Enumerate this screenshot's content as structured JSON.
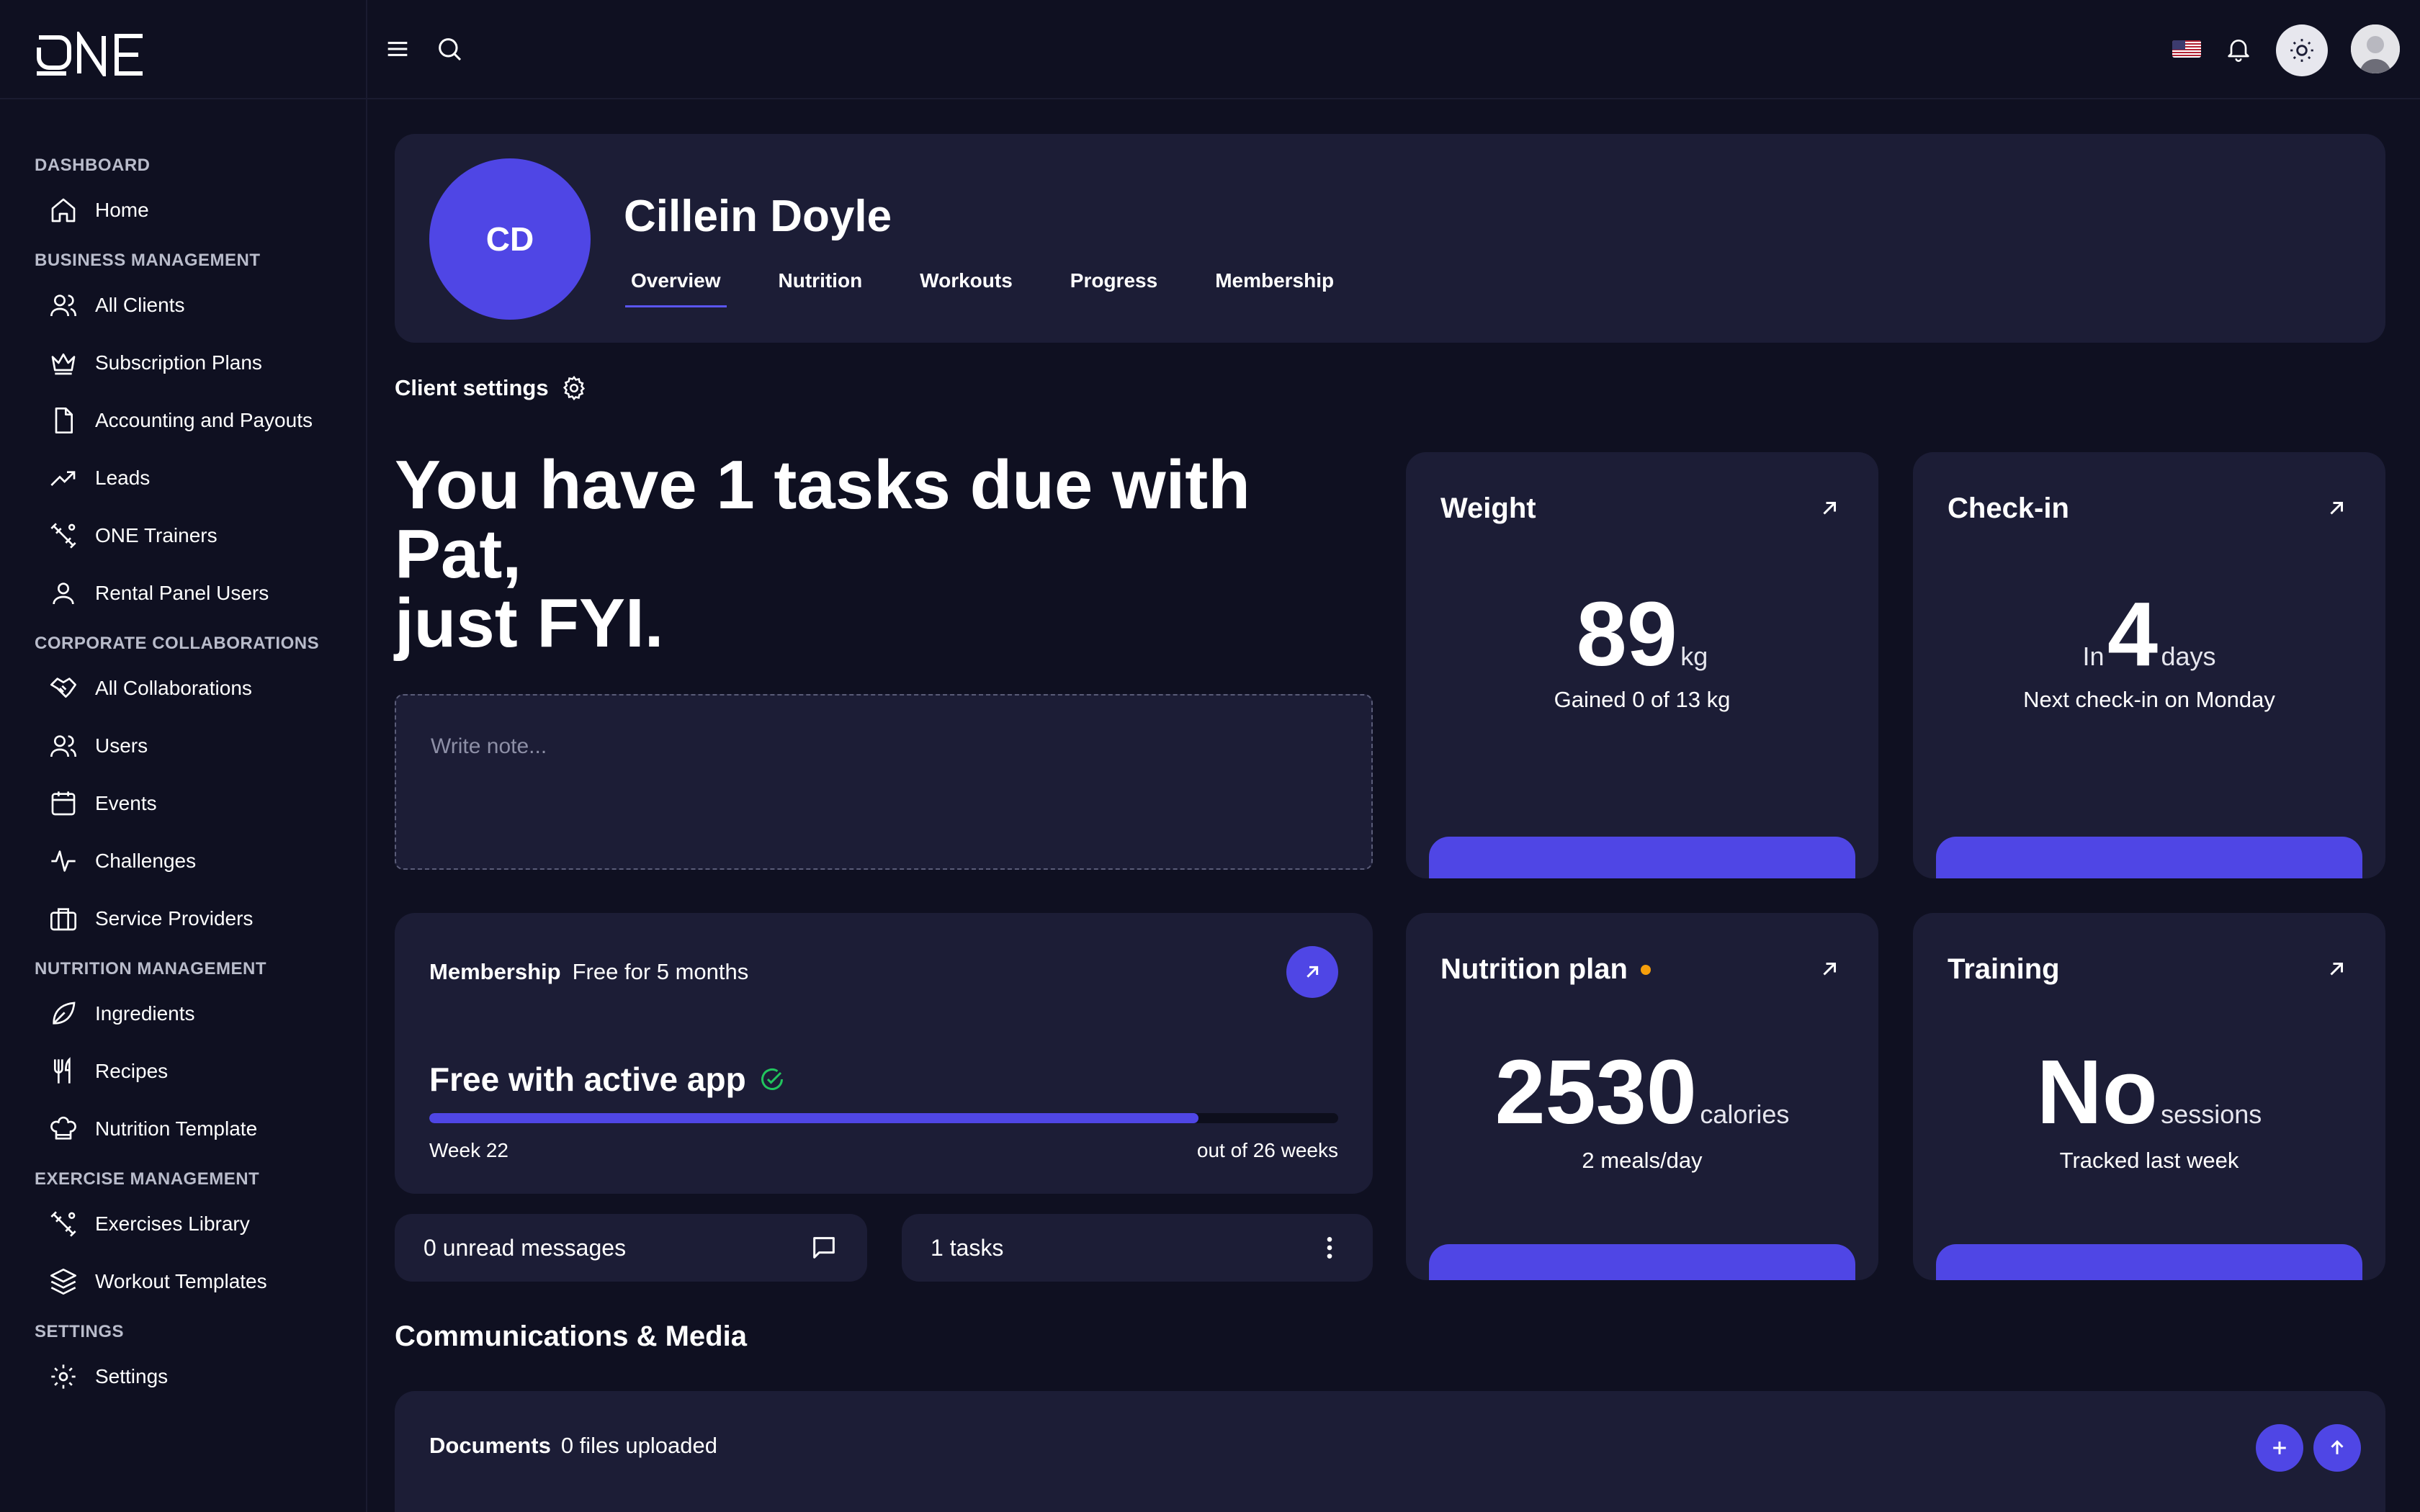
{
  "app": {
    "logo_text": "ONE"
  },
  "sidebar": {
    "sections": [
      {
        "title": "DASHBOARD",
        "items": [
          {
            "label": "Home",
            "icon": "home-icon"
          }
        ]
      },
      {
        "title": "BUSINESS MANAGEMENT",
        "items": [
          {
            "label": "All Clients",
            "icon": "users-icon"
          },
          {
            "label": "Subscription Plans",
            "icon": "crown-icon"
          },
          {
            "label": "Accounting and Payouts",
            "icon": "file-icon"
          },
          {
            "label": "Leads",
            "icon": "trending-up-icon"
          },
          {
            "label": "ONE Trainers",
            "icon": "dumbbell-icon"
          },
          {
            "label": "Rental Panel Users",
            "icon": "user-icon"
          }
        ]
      },
      {
        "title": "CORPORATE COLLABORATIONS",
        "items": [
          {
            "label": "All Collaborations",
            "icon": "handshake-icon"
          },
          {
            "label": "Users",
            "icon": "users-icon"
          },
          {
            "label": "Events",
            "icon": "calendar-icon"
          },
          {
            "label": "Challenges",
            "icon": "activity-icon"
          },
          {
            "label": "Service Providers",
            "icon": "briefcase-icon"
          }
        ]
      },
      {
        "title": "NUTRITION MANAGEMENT",
        "items": [
          {
            "label": "Ingredients",
            "icon": "leaf-icon"
          },
          {
            "label": "Recipes",
            "icon": "utensils-icon"
          },
          {
            "label": "Nutrition Template",
            "icon": "chef-hat-icon"
          }
        ]
      },
      {
        "title": "EXERCISE MANAGEMENT",
        "items": [
          {
            "label": "Exercises Library",
            "icon": "dumbbell-icon"
          },
          {
            "label": "Workout Templates",
            "icon": "layers-icon"
          }
        ]
      },
      {
        "title": "SETTINGS",
        "items": [
          {
            "label": "Settings",
            "icon": "gear-icon"
          }
        ]
      }
    ]
  },
  "profile": {
    "initials": "CD",
    "name": "Cillein Doyle",
    "tabs": [
      "Overview",
      "Nutrition",
      "Workouts",
      "Progress",
      "Membership"
    ],
    "active_tab": "Overview"
  },
  "client_settings_label": "Client settings",
  "headline": {
    "line1": "You have 1 tasks due with",
    "line2": "Pat,",
    "line3": "just FYI."
  },
  "note": {
    "placeholder": "Write note..."
  },
  "weight": {
    "title": "Weight",
    "value": "89",
    "unit": "kg",
    "sub": "Gained 0 of 13 kg"
  },
  "checkin": {
    "title": "Check-in",
    "prefix": "In",
    "value": "4",
    "unit": "days",
    "sub": "Next check-in on Monday"
  },
  "nutrition": {
    "title": "Nutrition plan",
    "value": "2530",
    "unit": "calories",
    "sub": "2 meals/day",
    "dot_color": "#f59e0b"
  },
  "training": {
    "title": "Training",
    "value": "No",
    "unit": "sessions",
    "sub": "Tracked last week"
  },
  "membership": {
    "label": "Membership",
    "detail": "Free for 5 months",
    "status": "Free with active app",
    "week_current": "Week 22",
    "week_total": "out of 26 weeks",
    "progress_fraction": 0.846
  },
  "messages": {
    "label": "0 unread messages"
  },
  "tasks": {
    "label": "1 tasks"
  },
  "communications_title": "Communications & Media",
  "documents": {
    "label": "Documents",
    "detail": "0 files uploaded"
  },
  "colors": {
    "accent": "#4f46e5",
    "background": "#0f1021",
    "card": "#1c1d36",
    "success": "#22c55e"
  }
}
